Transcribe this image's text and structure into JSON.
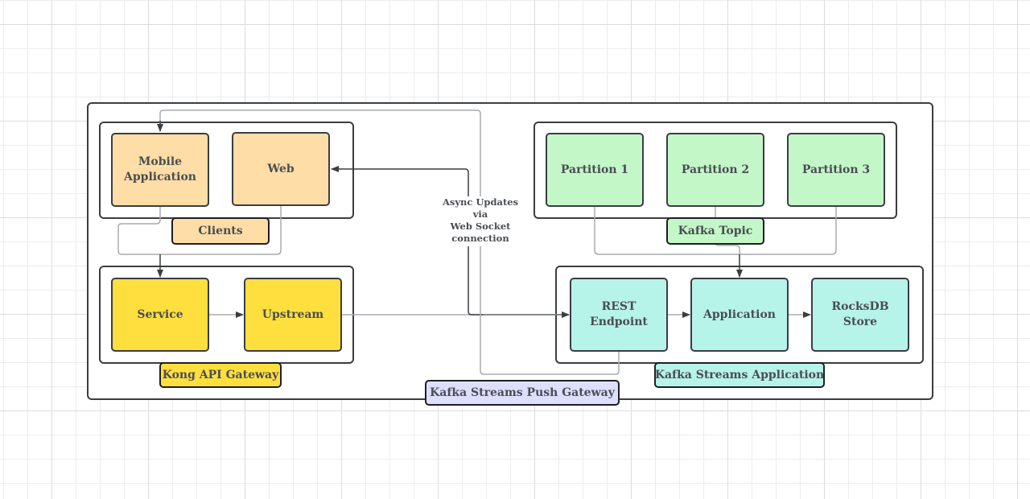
{
  "diagram": {
    "container": {
      "label": "Kafka Streams Push Gateway",
      "color": "#dedeff"
    },
    "groups": {
      "clients": {
        "label": "Clients",
        "color": "#fedda6",
        "nodes": {
          "mobile": "Mobile\nApplication",
          "web": "Web"
        }
      },
      "kong": {
        "label": "Kong API Gateway",
        "color": "#ffdf3e",
        "nodes": {
          "service": "Service",
          "upstream": "Upstream"
        }
      },
      "topic": {
        "label": "Kafka Topic",
        "color": "#c3f7c8",
        "nodes": {
          "p1": "Partition 1",
          "p2": "Partition 2",
          "p3": "Partition 3"
        }
      },
      "streams": {
        "label": "Kafka Streams Application",
        "color": "#b6f3e9",
        "nodes": {
          "rest": "REST\nEndpoint",
          "app": "Application",
          "rocks": "RocksDB\nStore"
        }
      }
    },
    "edge_note": "Async Updates\nvia\nWeb Socket\nconnection",
    "edges": [
      {
        "from": "Mobile Application",
        "to": "Service"
      },
      {
        "from": "Web",
        "to": "Service"
      },
      {
        "from": "Service",
        "to": "Upstream"
      },
      {
        "from": "Upstream",
        "to": "REST Endpoint"
      },
      {
        "from": "REST Endpoint",
        "to": "Application"
      },
      {
        "from": "Application",
        "to": "RocksDB Store"
      },
      {
        "from": "Partition 1",
        "to": "Application"
      },
      {
        "from": "Partition 2",
        "to": "Application"
      },
      {
        "from": "Partition 3",
        "to": "Application"
      },
      {
        "from": "REST Endpoint",
        "to": "Web",
        "label": "Async Updates via Web Socket connection"
      },
      {
        "from": "REST Endpoint",
        "to": "Mobile Application"
      }
    ]
  }
}
